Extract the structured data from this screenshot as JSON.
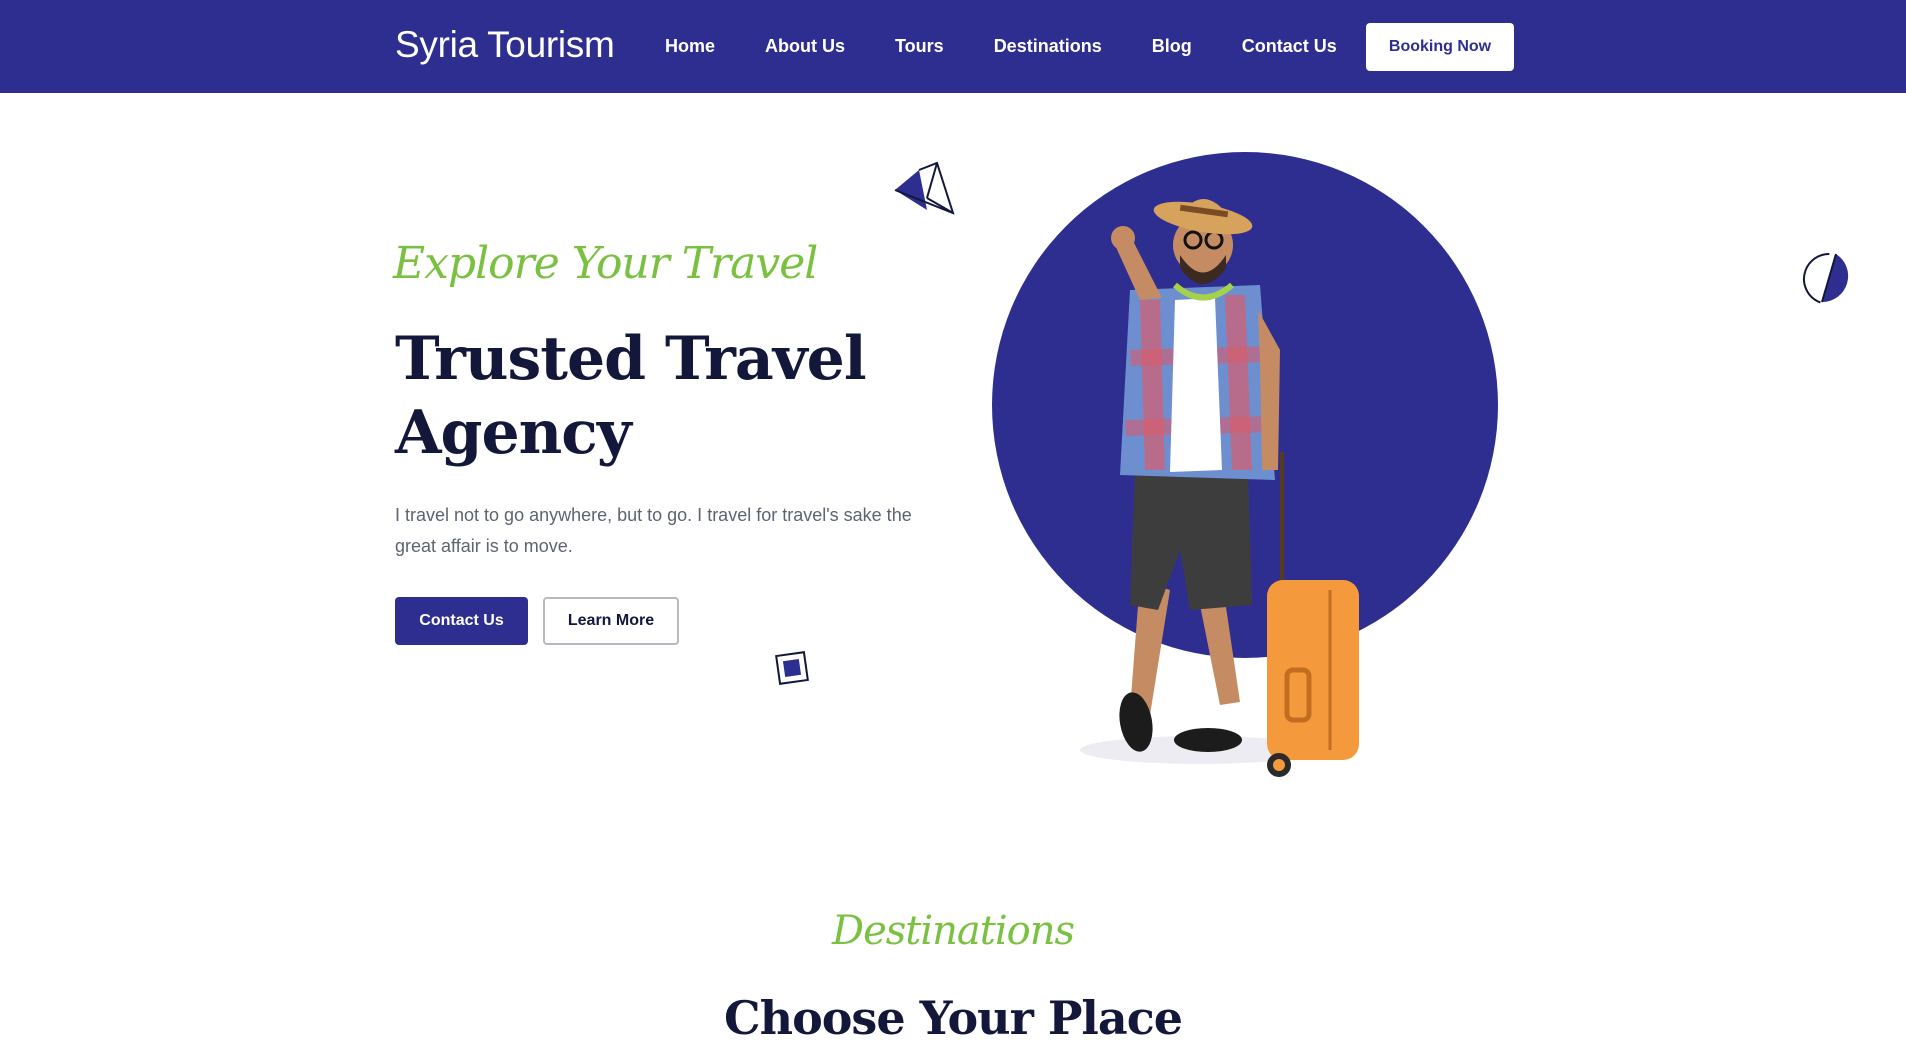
{
  "brand": {
    "name": "Syria Tourism"
  },
  "nav": {
    "links": [
      "Home",
      "About Us",
      "Tours",
      "Destinations",
      "Blog",
      "Contact Us"
    ],
    "cta_label": "Booking Now"
  },
  "hero": {
    "script_heading": "Explore Your Travel",
    "title": "Trusted Travel Agency",
    "text": "I travel not to go anywhere, but to go. I travel for travel's sake the great affair is to move.",
    "primary_button": "Contact Us",
    "secondary_button": "Learn More"
  },
  "destinations": {
    "script_heading": "Destinations",
    "title": "Choose Your Place"
  },
  "colors": {
    "primary": "#2e2e91",
    "accent_green": "#7ac142",
    "heading": "#13183a",
    "body_text": "#5d6470",
    "suitcase": "#f59a3c"
  },
  "icons": [
    "paper-plane-triangle-icon",
    "square-outline-icon",
    "half-circle-icon"
  ]
}
